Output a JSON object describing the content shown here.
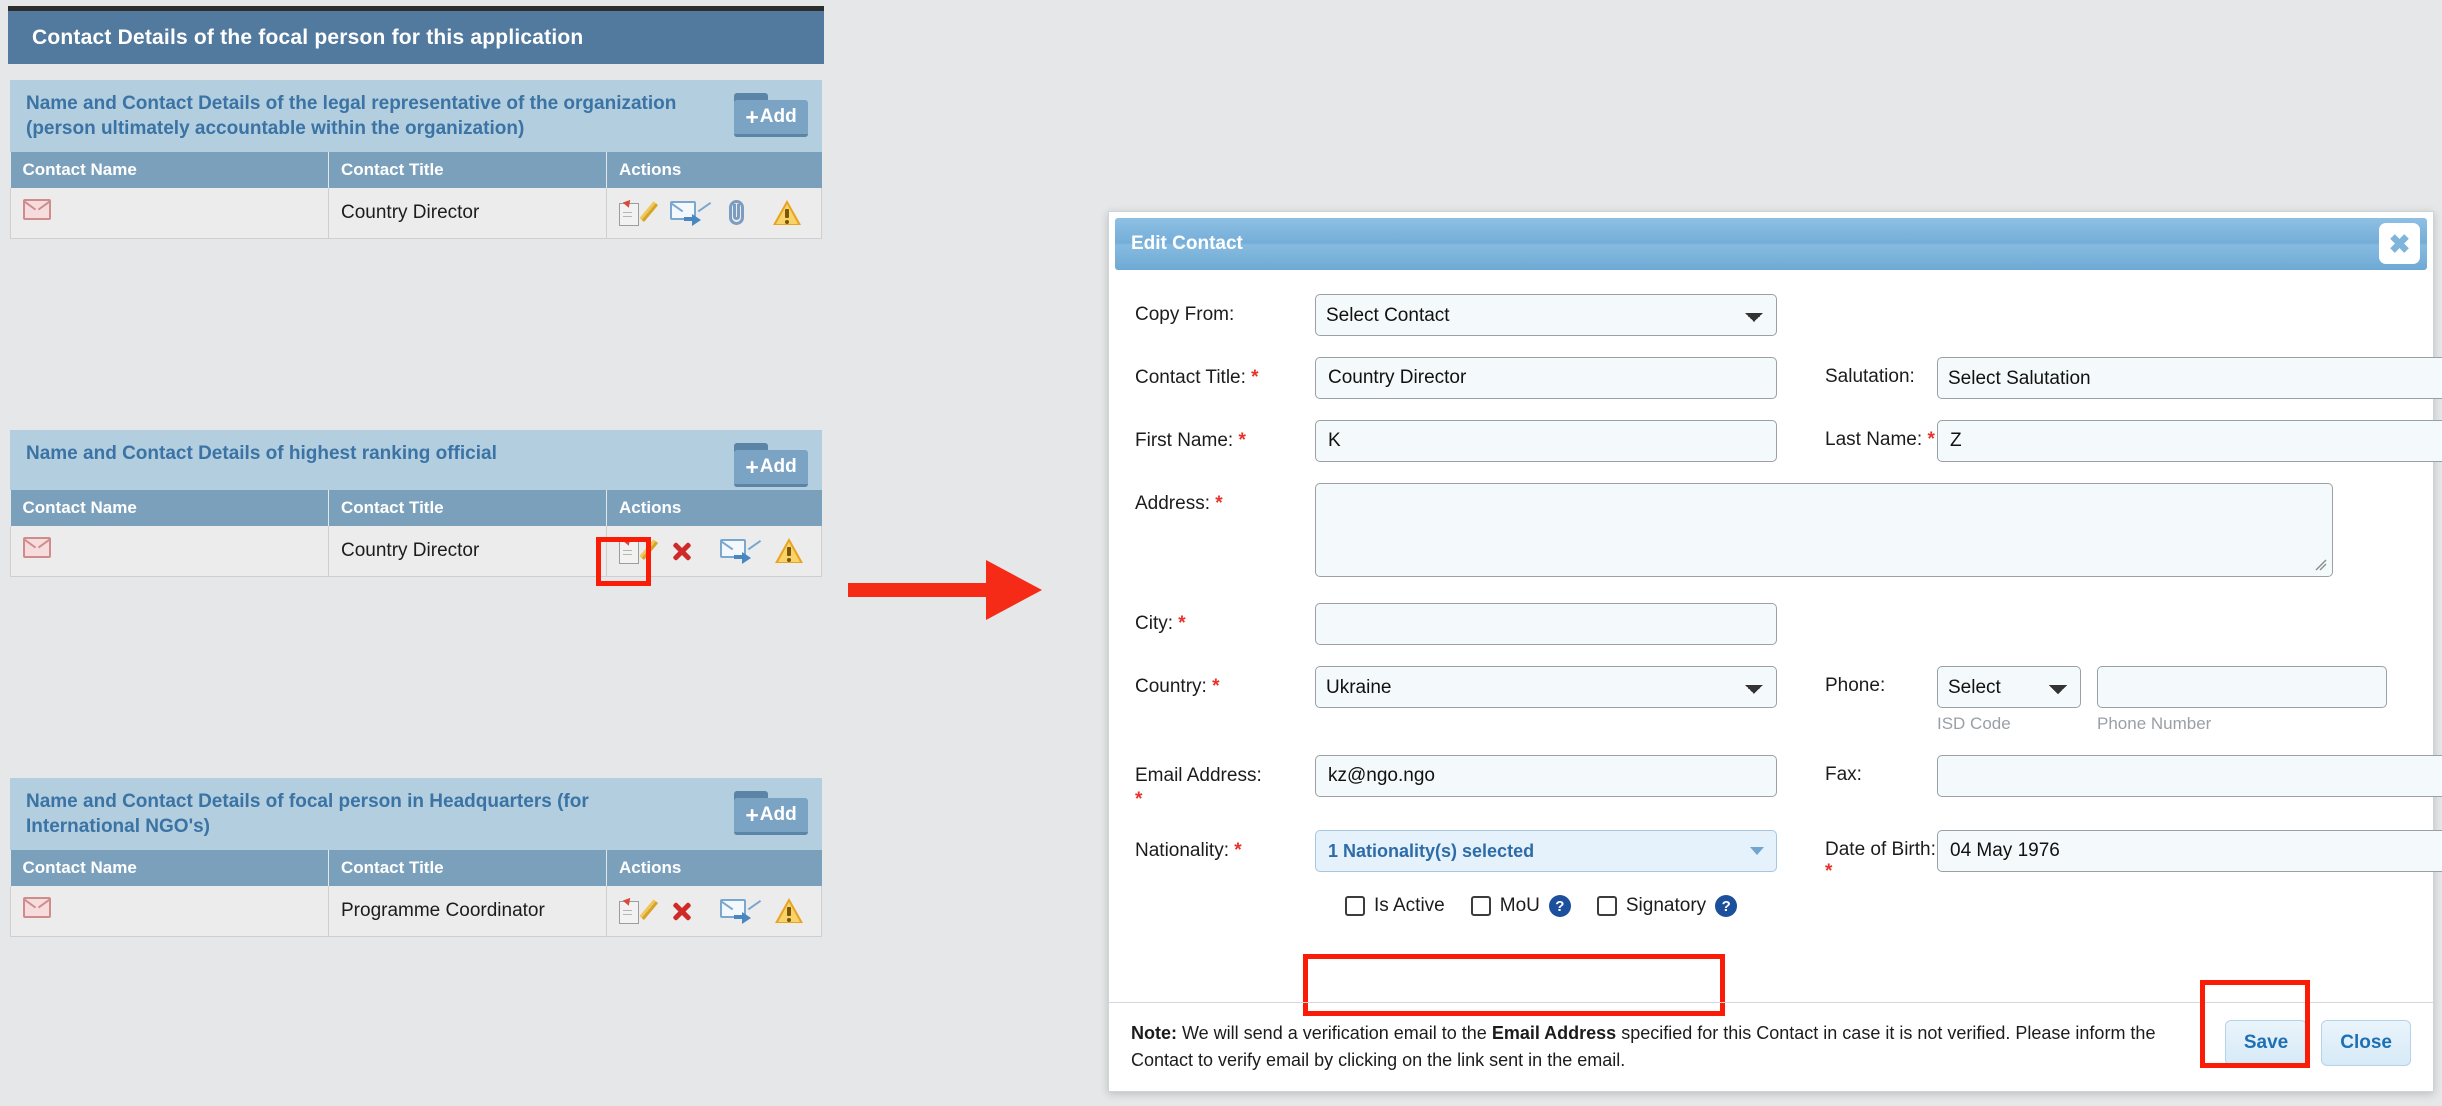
{
  "page": {
    "header_title": "Contact Details of the focal person for this application"
  },
  "groups": [
    {
      "title": "Name and Contact Details of the legal representative of the organization (person ultimately accountable within the organization)",
      "add_label": "Add",
      "columns": [
        "Contact Name",
        "Contact Title",
        "Actions"
      ],
      "row": {
        "contact_name_icon": "envelope-icon",
        "contact_title": "Country Director",
        "actions": [
          "edit-icon",
          "send-email-icon",
          "paperclip-icon",
          "warning-icon"
        ]
      }
    },
    {
      "title": "Name and Contact Details of highest ranking official",
      "add_label": "Add",
      "columns": [
        "Contact Name",
        "Contact Title",
        "Actions"
      ],
      "row": {
        "contact_name_icon": "envelope-icon",
        "contact_title": "Country Director",
        "actions": [
          "edit-icon",
          "delete-icon",
          "send-email-icon",
          "warning-icon"
        ]
      }
    },
    {
      "title": "Name and Contact Details of focal person in Headquarters (for International NGO's)",
      "add_label": "Add",
      "columns": [
        "Contact Name",
        "Contact Title",
        "Actions"
      ],
      "row": {
        "contact_name_icon": "envelope-icon",
        "contact_title": "Programme Coordinator",
        "actions": [
          "edit-icon",
          "delete-icon",
          "send-email-icon",
          "warning-icon"
        ]
      }
    }
  ],
  "annotations": {
    "highlight_color": "#fb1c08",
    "arrow_color": "#f62b17"
  },
  "modal": {
    "title": "Edit Contact",
    "close_glyph": "✖",
    "fields": {
      "copy_from_label": "Copy From:",
      "copy_from_value": "Select Contact",
      "contact_title_label": "Contact Title:",
      "contact_title_value": "Country Director",
      "salutation_label": "Salutation:",
      "salutation_value": "Select Salutation",
      "first_name_label": "First Name:",
      "first_name_value": "K",
      "last_name_label": "Last Name:",
      "last_name_value": "Z",
      "address_label": "Address:",
      "address_value": "",
      "city_label": "City:",
      "city_value": "",
      "country_label": "Country:",
      "country_value": "Ukraine",
      "phone_label": "Phone:",
      "isd_value": "Select",
      "isd_helper": "ISD Code",
      "phone_number_value": "",
      "phone_helper": "Phone Number",
      "email_label": "Email Address:",
      "email_value": "kz@ngo.ngo",
      "fax_label": "Fax:",
      "fax_value": "",
      "nationality_label": "Nationality:",
      "nationality_value": "1 Nationality(s) selected",
      "dob_label": "Date of Birth:",
      "dob_value": "04 May 1976"
    },
    "checkboxes": [
      {
        "label": "Is Active",
        "has_help": false,
        "checked": false
      },
      {
        "label": "MoU",
        "has_help": true,
        "checked": false
      },
      {
        "label": "Signatory",
        "has_help": true,
        "checked": false
      }
    ],
    "help_glyph": "?",
    "note": {
      "prefix": "Note:",
      "part1": " We will send a verification email to the ",
      "bold": "Email Address",
      "part2": " specified for this Contact in case it is not verified. Please inform the Contact to verify email by clicking on the link sent in the email."
    },
    "save_label": "Save",
    "close_label": "Close"
  }
}
